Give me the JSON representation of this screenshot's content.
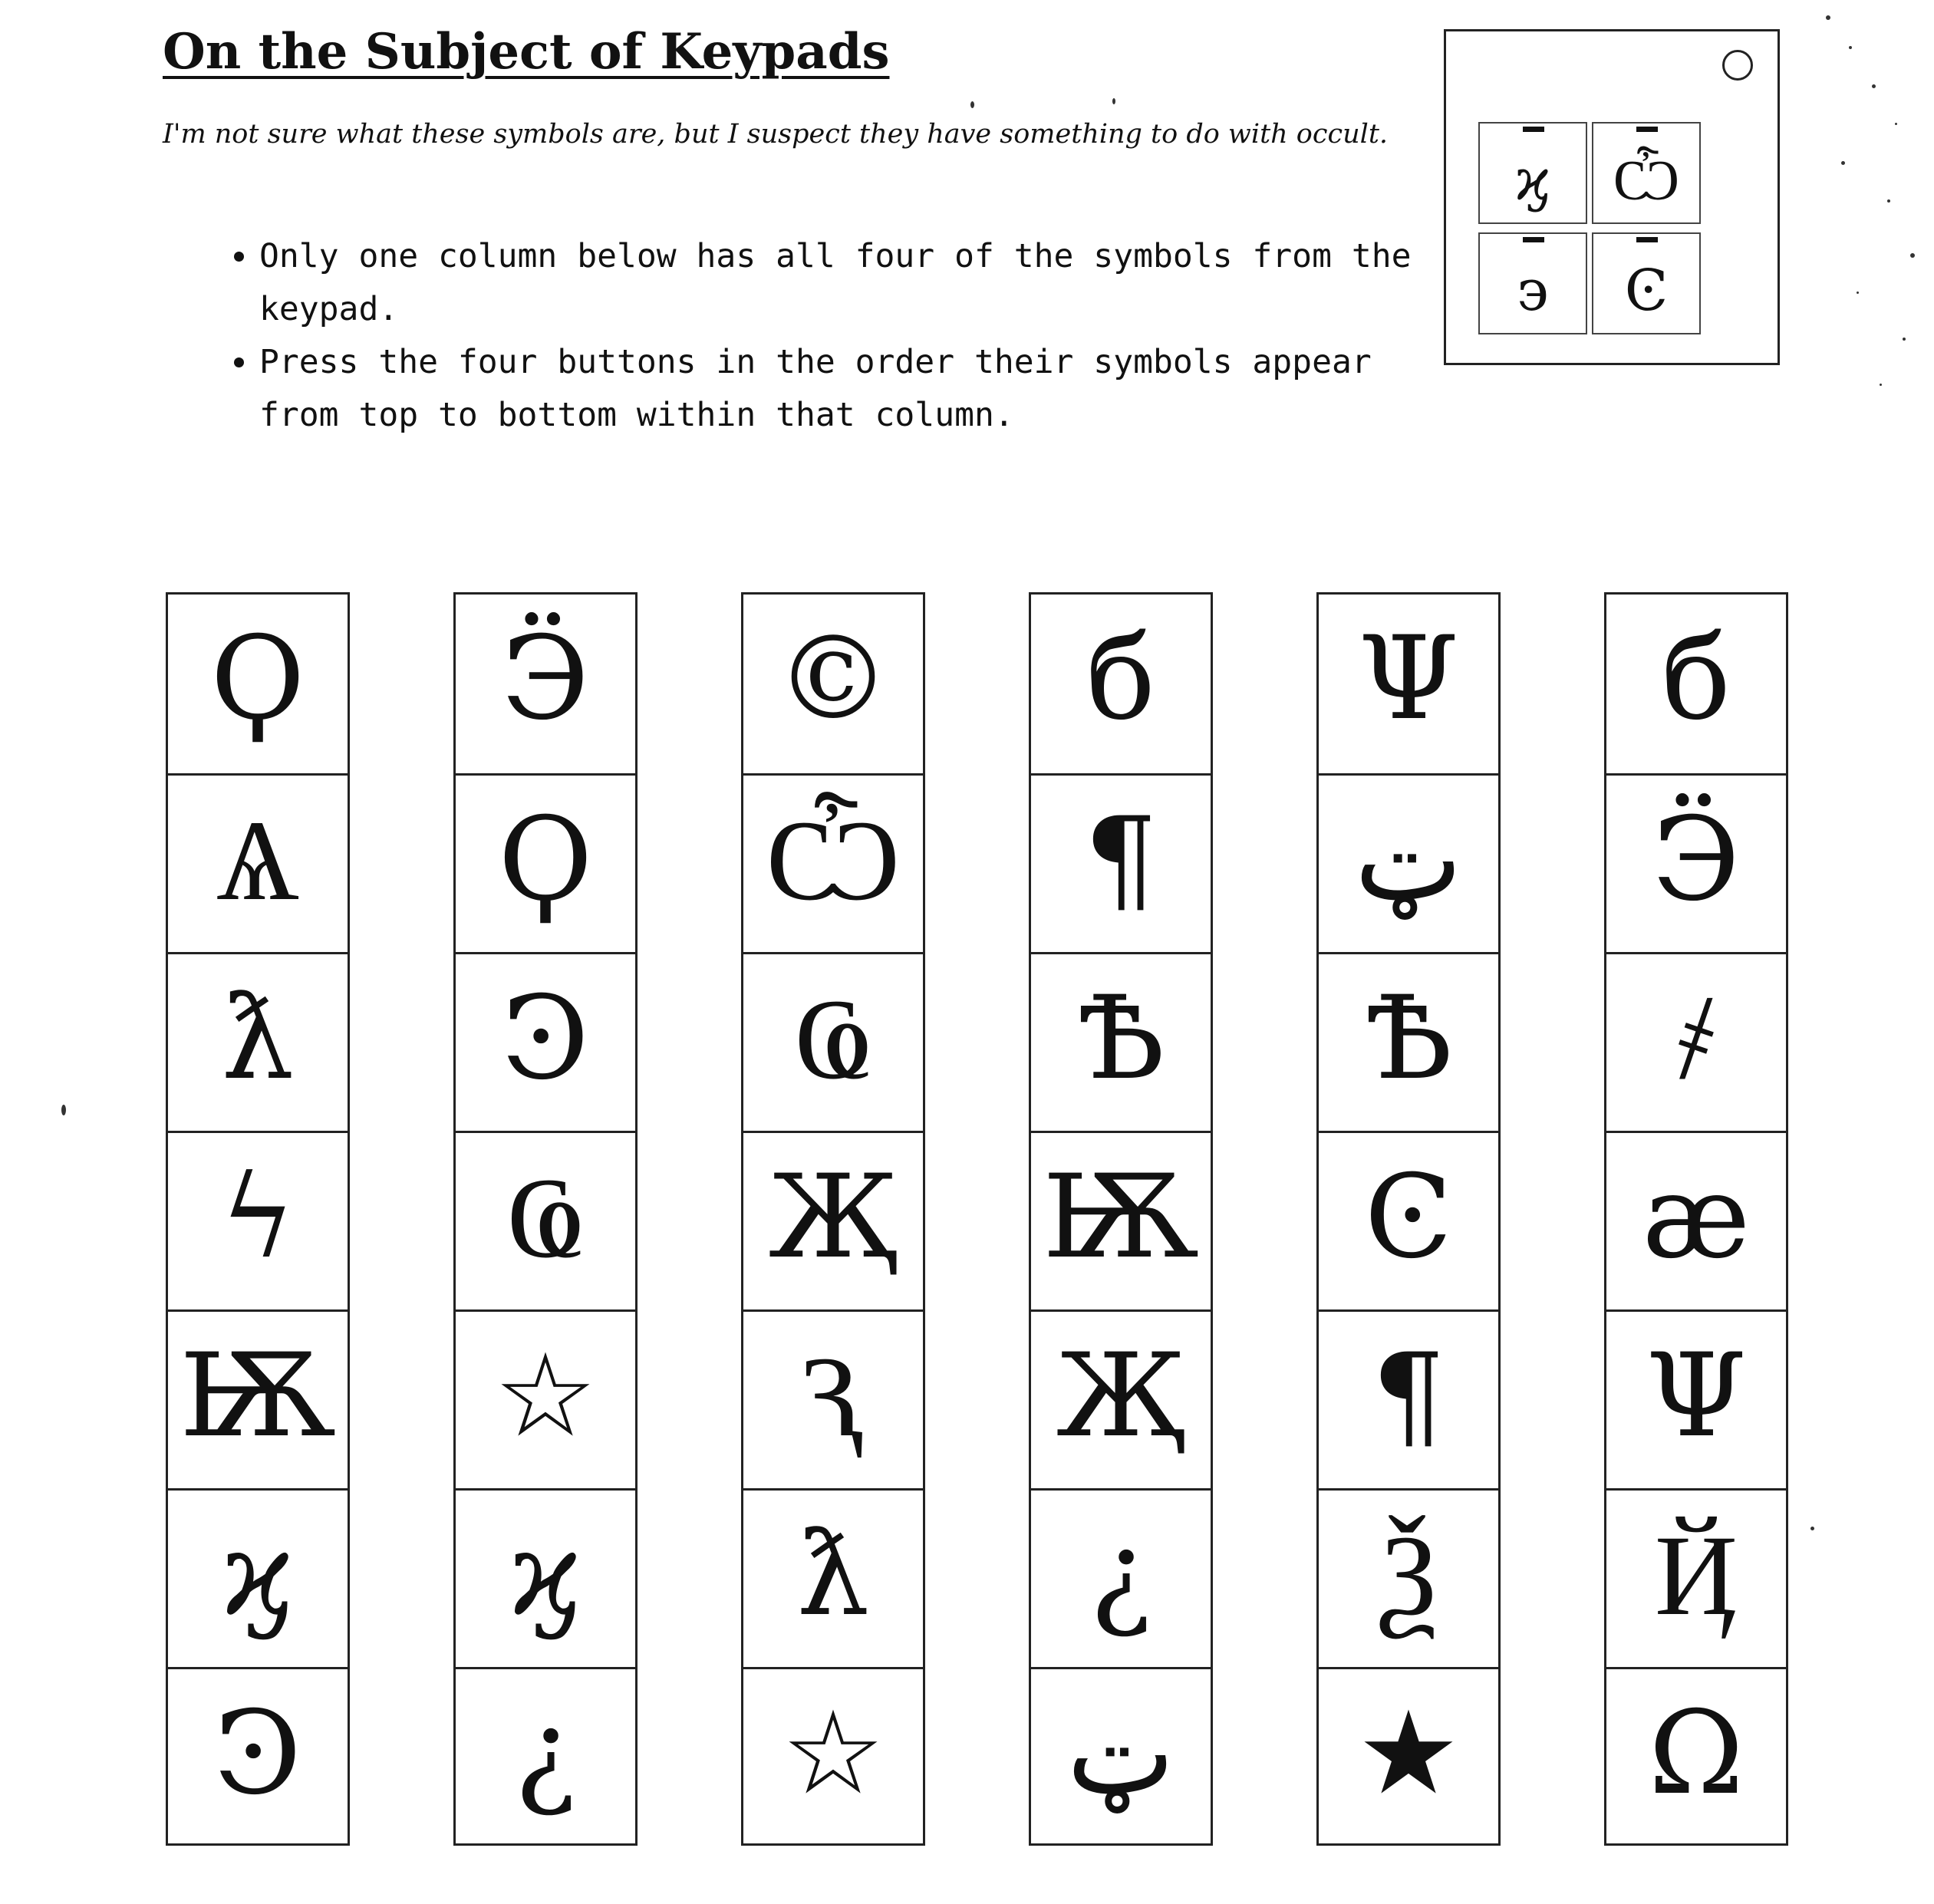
{
  "title": "On the Subject of Keypads",
  "flavor_text": "I'm not sure what these symbols are, but I suspect they have something to do with occult.",
  "rules": [
    "Only one column below has all four of the symbols from the keypad.",
    "Press the four buttons in the order their symbols appear from top to bottom within that column."
  ],
  "module": {
    "keys": [
      "ϗ",
      "Ѽ",
      "϶",
      "Ͼ"
    ]
  },
  "columns": [
    [
      "Ϙ",
      "Ѧ",
      "ƛ",
      "ϟ",
      "Ѭ",
      "ϗ",
      "Ͽ"
    ],
    [
      "Ӭ",
      "Ϙ",
      "Ͽ",
      "Ҩ",
      "☆",
      "ϗ",
      "¿"
    ],
    [
      "©",
      "Ѽ",
      "Ҩ",
      "Җ",
      "Ԇ",
      "ƛ",
      "☆"
    ],
    [
      "б",
      "¶",
      "Ѣ",
      "Ѭ",
      "Җ",
      "¿",
      "ټ"
    ],
    [
      "Ψ",
      "ټ",
      "Ѣ",
      "Ͼ",
      "¶",
      "Ѯ",
      "★"
    ],
    [
      "б",
      "Ӭ",
      "҂",
      "æ",
      "Ψ",
      "Ҋ",
      "Ω"
    ]
  ]
}
